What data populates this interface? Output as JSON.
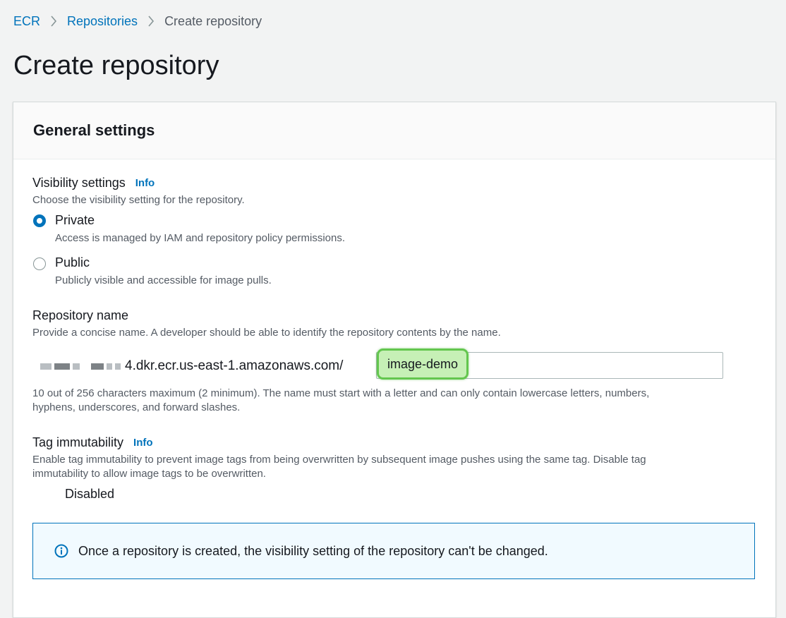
{
  "breadcrumb": {
    "items": [
      "ECR",
      "Repositories"
    ],
    "current": "Create repository"
  },
  "page_title": "Create repository",
  "general": {
    "title": "General settings",
    "visibility": {
      "label": "Visibility settings",
      "info": "Info",
      "description": "Choose the visibility setting for the repository.",
      "options": [
        {
          "label": "Private",
          "description": "Access is managed by IAM and repository policy permissions.",
          "selected": true
        },
        {
          "label": "Public",
          "description": "Publicly visible and accessible for image pulls.",
          "selected": false
        }
      ]
    },
    "repo_name": {
      "label": "Repository name",
      "description": "Provide a concise name. A developer should be able to identify the repository contents by the name.",
      "prefix": "4.dkr.ecr.us-east-1.amazonaws.com/",
      "value": "image-demo",
      "constraint_line1": "10 out of 256 characters maximum (2 minimum). The name must start with a letter and can only contain lowercase letters, numbers,",
      "constraint_line2": "hyphens, underscores, and forward slashes."
    },
    "tag_immutability": {
      "label": "Tag immutability",
      "info": "Info",
      "description_line1": "Enable tag immutability to prevent image tags from being overwritten by subsequent image pushes using the same tag. Disable tag",
      "description_line2": "immutability to allow image tags to be overwritten.",
      "toggle_label": "Disabled",
      "enabled": false
    },
    "alert": {
      "text": "Once a repository is created, the visibility setting of the repository can't be changed."
    }
  },
  "colors": {
    "link": "#0073bb",
    "highlight_fill": "#c6f0b6",
    "highlight_border": "#63c64e"
  }
}
